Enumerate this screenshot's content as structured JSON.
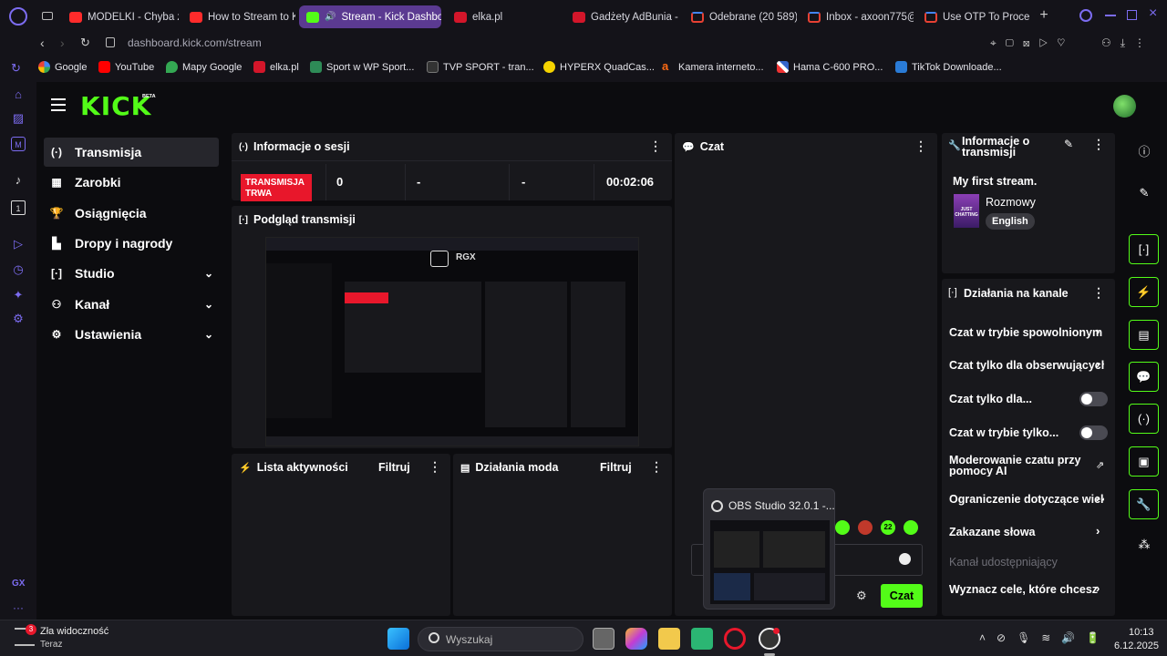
{
  "tabs": [
    {
      "title": "MODELKI - Chyba z"
    },
    {
      "title": "How to Stream to K"
    },
    {
      "title": "Stream - Kick Dashbo"
    },
    {
      "title": "elka.pl"
    },
    {
      "title": "Gadżety AdBunia -"
    },
    {
      "title": "Odebrane (20 589)"
    },
    {
      "title": "Inbox - axoon775@"
    },
    {
      "title": "Use OTP To Proce"
    }
  ],
  "address": "dashboard.kick.com/stream",
  "bookmarks": [
    "Google",
    "YouTube",
    "Mapy Google",
    "elka.pl",
    "Sport w WP Sport...",
    "TVP SPORT - tran...",
    "HYPERX QuadCas...",
    "Kamera interneto...",
    "Hama C-600 PRO...",
    "TikTok Downloade..."
  ],
  "opera_sidebar": {
    "gx_label": "GX"
  },
  "brand": {
    "logo": "KICK",
    "beta": "BETA"
  },
  "nav": {
    "items": [
      {
        "label": "Transmisja",
        "icon": "(·)"
      },
      {
        "label": "Zarobki",
        "icon": "▦"
      },
      {
        "label": "Osiągnięcia",
        "icon": "🏆"
      },
      {
        "label": "Dropy i nagrody",
        "icon": "▙"
      },
      {
        "label": "Studio",
        "icon": "[·]"
      },
      {
        "label": "Kanał",
        "icon": "⚇"
      },
      {
        "label": "Ustawienia",
        "icon": "⚙"
      }
    ]
  },
  "session": {
    "title": "Informacje o sesji",
    "status_line1": "TRANSMISJA",
    "status_line2": "TRWA",
    "stat1": "0",
    "stat2": "-",
    "stat3": "-",
    "duration": "00:02:06"
  },
  "preview": {
    "title": "Podgląd transmisji",
    "overlay_label": "RGX"
  },
  "activity": {
    "title": "Lista aktywności",
    "filter": "Filtruj"
  },
  "modactions": {
    "title": "Działania moda",
    "filter": "Filtruj"
  },
  "chat": {
    "title": "Czat",
    "send": "Czat"
  },
  "obs_popup": {
    "title": "OBS Studio 32.0.1 -..."
  },
  "stream_info": {
    "title_line1": "Informacje o",
    "title_line2": "transmisji",
    "stream_title": "My first stream.",
    "category": "Rozmowy",
    "language": "English",
    "thumb_text": "JUST CHATTING"
  },
  "channel_actions": {
    "title": "Działania na kanale",
    "items": [
      {
        "label": "Czat w trybie spowolnionym",
        "type": "arrow"
      },
      {
        "label": "Czat tylko dla obserwujących",
        "type": "arrow"
      },
      {
        "label": "Czat tylko dla...",
        "type": "toggle"
      },
      {
        "label": "Czat w trybie tylko...",
        "type": "toggle"
      },
      {
        "label": "Moderowanie czatu przy",
        "label2": "pomocy AI",
        "type": "external"
      },
      {
        "label": "Ograniczenie dotyczące wieku",
        "type": "arrow"
      },
      {
        "label": "Zakazane słowa",
        "type": "arrow"
      },
      {
        "label": "Kanał udostępniający",
        "type": "disabled"
      },
      {
        "label": "Wyznacz cele, które chcesz",
        "type": "arrow"
      }
    ]
  },
  "emote_count": "22",
  "taskbar": {
    "weather_badge": "3",
    "weather_title": "Zła widoczność",
    "weather_sub": "Teraz",
    "search_placeholder": "Wyszukaj",
    "time": "10:13",
    "date": "6.12.2025"
  },
  "colors": {
    "kick_green": "#53fc18",
    "live_red": "#e8172b",
    "panel": "#18181c",
    "opera_purple": "#7c6cf0"
  }
}
